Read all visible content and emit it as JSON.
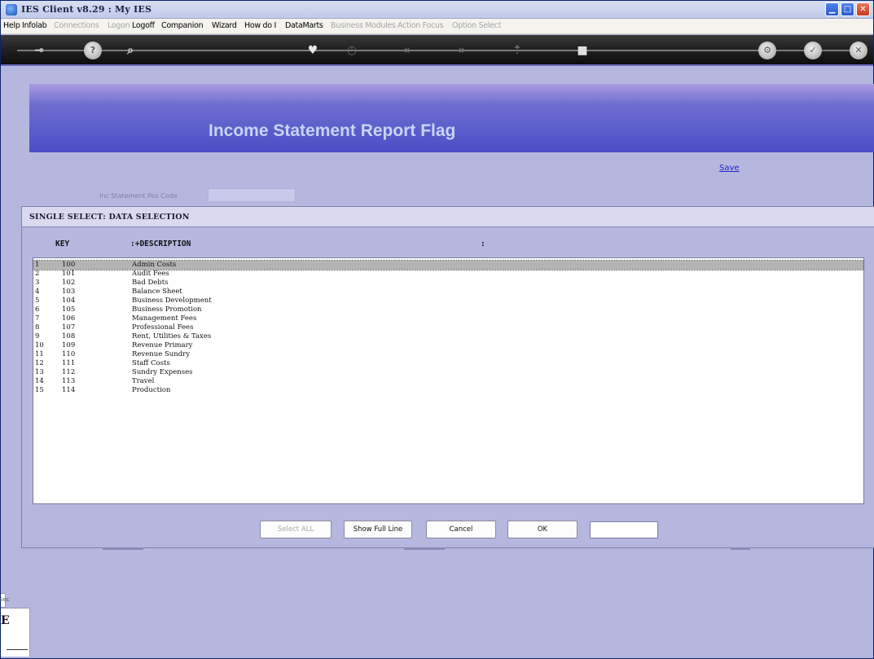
{
  "window": {
    "title": "IES Client v8.29 : My IES",
    "controls": {
      "minimize": "▁",
      "maximize": "□",
      "close": "✕"
    }
  },
  "menu": [
    {
      "label": "Help",
      "enabled": true
    },
    {
      "label": "Infolab",
      "enabled": true
    },
    {
      "label": "Connections",
      "enabled": false
    },
    {
      "label": "Logon",
      "enabled": false
    },
    {
      "label": "Logoff",
      "enabled": true
    },
    {
      "label": "Companion",
      "enabled": true
    },
    {
      "label": "Wizard",
      "enabled": true
    },
    {
      "label": "How do I",
      "enabled": true
    },
    {
      "label": "DataMarts",
      "enabled": true
    },
    {
      "label": "Business Modules",
      "enabled": false
    },
    {
      "label": "Action Focus",
      "enabled": false
    },
    {
      "label": "Option Select",
      "enabled": false
    }
  ],
  "toolbar": {
    "icons": [
      "key-icon",
      "help-icon",
      "search-icon",
      "heart-icon",
      "clock-icon",
      "back-icon",
      "forward-icon",
      "export-icon",
      "stop-icon",
      "settings-icon",
      "check-icon",
      "close-icon"
    ]
  },
  "page": {
    "heading": "Income Statement Report Flag",
    "save_label": "Save",
    "field_label": "Inc Statement Pos Code",
    "field_value": ""
  },
  "dialog": {
    "title": "SINGLE SELECT: DATA SELECTION",
    "columns": {
      "key": "KEY",
      "description": ":+DESCRIPTION",
      "extra": ":"
    },
    "rows": [
      {
        "num": "1",
        "key": "100",
        "desc": "Admin Costs",
        "selected": true
      },
      {
        "num": "2",
        "key": "101",
        "desc": "Audit Fees"
      },
      {
        "num": "3",
        "key": "102",
        "desc": "Bad Debts"
      },
      {
        "num": "4",
        "key": "103",
        "desc": "Balance Sheet"
      },
      {
        "num": "5",
        "key": "104",
        "desc": "Business Development"
      },
      {
        "num": "6",
        "key": "105",
        "desc": "Business Promotion"
      },
      {
        "num": "7",
        "key": "106",
        "desc": "Management Fees"
      },
      {
        "num": "8",
        "key": "107",
        "desc": "Professional Fees"
      },
      {
        "num": "9",
        "key": "108",
        "desc": "Rent, Utilities & Taxes"
      },
      {
        "num": "10",
        "key": "109",
        "desc": "Revenue Primary"
      },
      {
        "num": "11",
        "key": "110",
        "desc": "Revenue Sundry"
      },
      {
        "num": "12",
        "key": "111",
        "desc": "Staff Costs"
      },
      {
        "num": "13",
        "key": "112",
        "desc": "Sundry Expenses"
      },
      {
        "num": "14",
        "key": "113",
        "desc": "Travel"
      },
      {
        "num": "15",
        "key": "114",
        "desc": "Production"
      }
    ],
    "buttons": {
      "select_all": "Select ALL",
      "show_full_line": "Show Full Line",
      "cancel": "Cancel",
      "ok": "OK"
    },
    "input_value": ""
  },
  "status": {
    "left_label": "Sec",
    "glyph": "E"
  },
  "colors": {
    "background": "#b6b7df",
    "banner_heading": "#c9d4f6",
    "selected_row": "#b4b4b4",
    "link": "#2222cc"
  }
}
